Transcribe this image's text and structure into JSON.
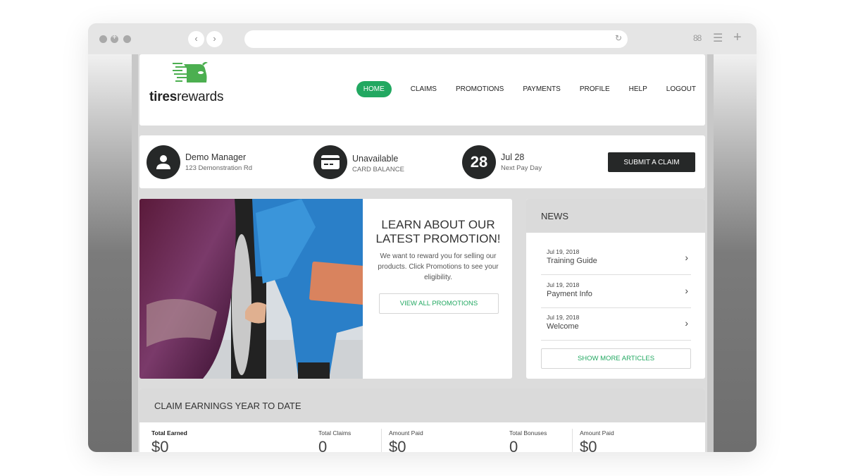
{
  "browser": {
    "back_label": "‹",
    "forward_label": "›",
    "reload_icon": "↻",
    "grid_icon": "88",
    "menu_icon": "☰",
    "new_tab_icon": "+"
  },
  "brand": {
    "accent": "#22a861",
    "dark": "#262828",
    "logo_bold": "tires",
    "logo_light": "rewards"
  },
  "nav": {
    "items": [
      {
        "label": "HOME",
        "active": true
      },
      {
        "label": "CLAIMS"
      },
      {
        "label": "PROMOTIONS"
      },
      {
        "label": "PAYMENTS"
      },
      {
        "label": "PROFILE"
      },
      {
        "label": "HELP"
      },
      {
        "label": "LOGOUT"
      }
    ]
  },
  "info": {
    "user_name": "Demo Manager",
    "user_address": "123 Demonstration Rd",
    "card_status": "Unavailable",
    "card_label": "CARD BALANCE",
    "pay_day_number": "28",
    "pay_day_date": "Jul 28",
    "pay_day_label": "Next Pay Day",
    "submit_label": "SUBMIT A CLAIM"
  },
  "promo": {
    "title_line1": "LEARN ABOUT OUR",
    "title_line2": "LATEST PROMOTION!",
    "text": "We want to reward you for selling our products. Click Promotions to see your eligibility.",
    "button_label": "VIEW ALL PROMOTIONS"
  },
  "news": {
    "title": "NEWS",
    "items": [
      {
        "date": "Jul 19, 2018",
        "title": "Training Guide"
      },
      {
        "date": "Jul 19, 2018",
        "title": "Payment Info"
      },
      {
        "date": "Jul 19, 2018",
        "title": "Welcome"
      }
    ],
    "more_label": "SHOW MORE ARTICLES",
    "chevron": "›"
  },
  "earnings": {
    "title": "CLAIM EARNINGS YEAR TO DATE",
    "stats": [
      {
        "label": "Total Earned",
        "value": "$0"
      },
      {
        "label": "Total Claims",
        "value": "0"
      },
      {
        "label": "Amount Paid",
        "value": "$0"
      },
      {
        "label": "Total Bonuses",
        "value": "0"
      },
      {
        "label": "Amount Paid",
        "value": "$0"
      }
    ]
  }
}
